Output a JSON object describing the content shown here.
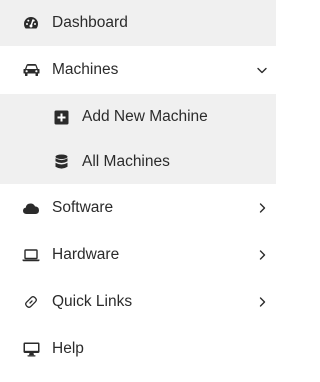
{
  "menu": {
    "items": [
      {
        "label": "Dashboard",
        "icon": "dashboard-gauge-icon"
      },
      {
        "label": "Machines",
        "icon": "car-icon",
        "expanded": true,
        "children": [
          {
            "label": "Add New Machine",
            "icon": "plus-square-icon"
          },
          {
            "label": "All Machines",
            "icon": "database-icon"
          }
        ]
      },
      {
        "label": "Software",
        "icon": "cloud-icon"
      },
      {
        "label": "Hardware",
        "icon": "laptop-icon"
      },
      {
        "label": "Quick Links",
        "icon": "link-icon"
      },
      {
        "label": "Help",
        "icon": "desktop-icon"
      }
    ]
  },
  "colors": {
    "shaded_bg": "#f0f0f0",
    "text": "#2b2b2b",
    "icon": "#2b2b2b"
  }
}
